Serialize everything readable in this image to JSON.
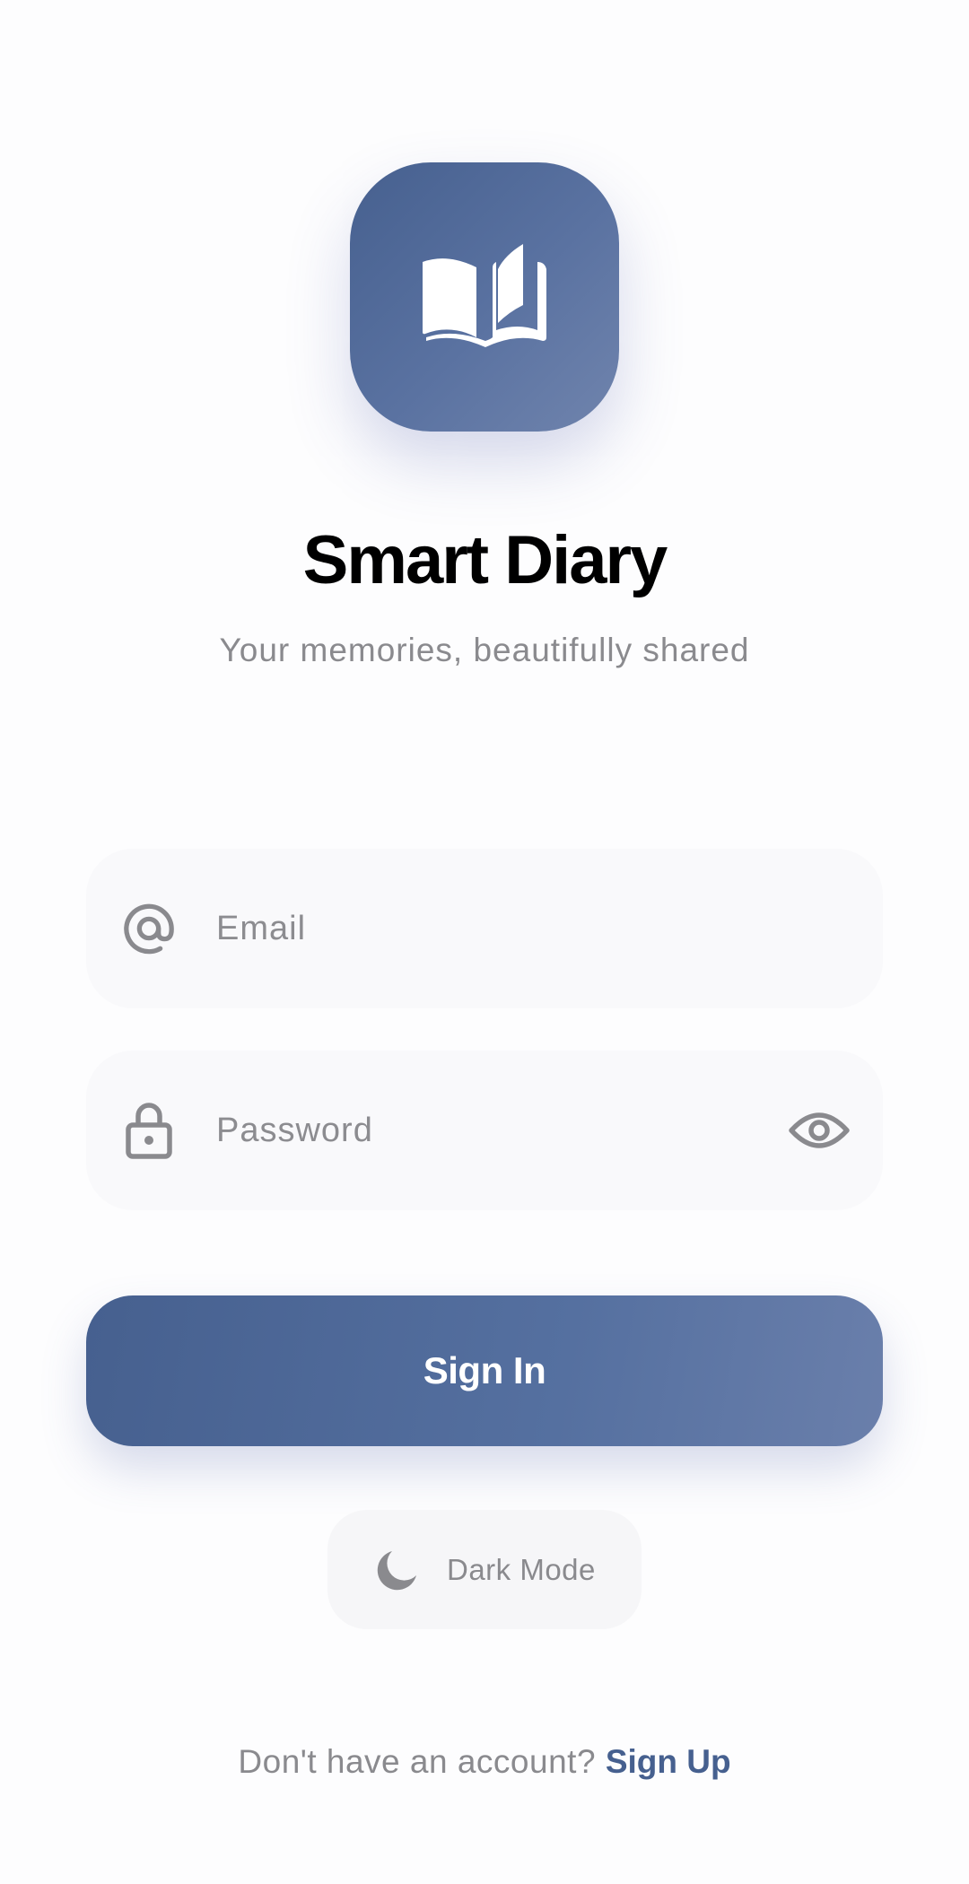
{
  "app": {
    "title": "Smart Diary",
    "subtitle": "Your memories, beautifully shared",
    "logo_icon": "open-book-icon",
    "accent_color": "#46608f"
  },
  "form": {
    "email": {
      "icon": "at-sign-icon",
      "placeholder": "Email",
      "value": ""
    },
    "password": {
      "icon": "lock-icon",
      "placeholder": "Password",
      "value": "",
      "toggle_icon": "eye-icon"
    },
    "submit_label": "Sign In"
  },
  "theme_toggle": {
    "icon": "moon-icon",
    "label": "Dark Mode"
  },
  "footer": {
    "prompt": "Don't have an account?",
    "link_label": "Sign Up"
  }
}
